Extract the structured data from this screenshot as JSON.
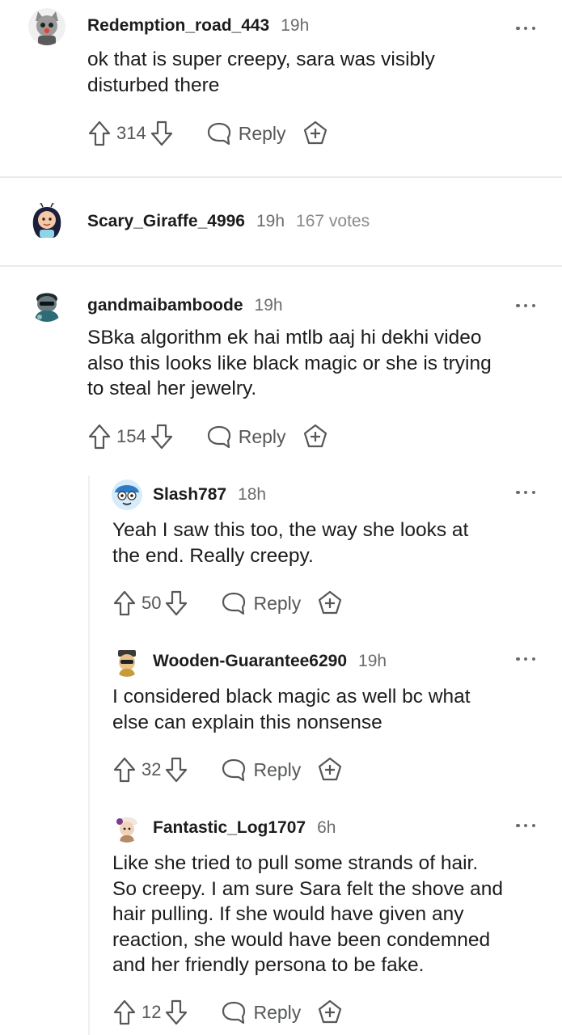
{
  "comments": [
    {
      "username": "Redemption_road_443",
      "time": "19h",
      "body": [
        "ok that is super creepy, sara was visibly",
        "disturbed there"
      ],
      "votes": "314",
      "reply_label": "Reply"
    },
    {
      "username": "Scary_Giraffe_4996",
      "time": "19h",
      "note": "167 votes"
    },
    {
      "username": "gandmaibamboode",
      "time": "19h",
      "body": [
        "SBka algorithm ek hai mtlb aaj hi dekhi video",
        "also this looks like black magic or she is trying",
        "to steal her jewelry."
      ],
      "votes": "154",
      "reply_label": "Reply"
    },
    {
      "username": "Slash787",
      "time": "18h",
      "body": [
        "Yeah I saw this too, the way she looks at",
        "the end. Really creepy."
      ],
      "votes": "50",
      "reply_label": "Reply"
    },
    {
      "username": "Wooden-Guarantee6290",
      "time": "19h",
      "body": [
        "I considered black magic as well bc what",
        "else can explain this nonsense"
      ],
      "votes": "32",
      "reply_label": "Reply"
    },
    {
      "username": "Fantastic_Log1707",
      "time": "6h",
      "body": [
        "Like she tried to pull some strands of hair.",
        "So creepy. I am sure Sara felt the shove and",
        "hair pulling. If she would have given any",
        "reaction, she would have been condemned",
        "and her friendly persona to be fake."
      ],
      "votes": "12",
      "reply_label": "Reply"
    }
  ],
  "colors": {
    "text": "#1c1c1c",
    "meta": "#6a6c6e",
    "icon": "#555759",
    "divider": "#e9eaeb"
  },
  "icons": [
    "upvote-icon",
    "downvote-icon",
    "reply-bubble-icon",
    "award-plus-icon",
    "more-options-icon"
  ]
}
